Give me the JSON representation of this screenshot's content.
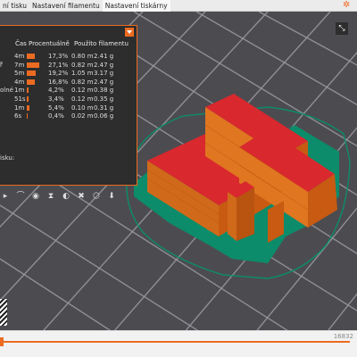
{
  "tabs": [
    "ní tisku",
    "Nastavení filamentu",
    "Nastavení tiskárny"
  ],
  "legend": {
    "headers": {
      "time": "Čas",
      "percent": "Procentuálně",
      "filament": "Použito filamentu"
    },
    "rows": [
      {
        "label": "",
        "time": "4m",
        "percent": "17,3%",
        "length": "0.80 m",
        "weight": "2.41 g",
        "bar": 0.173
      },
      {
        "label": "r",
        "time": "7m",
        "percent": "27,1%",
        "length": "0.82 m",
        "weight": "2.47 g",
        "bar": 0.271
      },
      {
        "label": "",
        "time": "5m",
        "percent": "19,2%",
        "length": "1.05 m",
        "weight": "3.17 g",
        "bar": 0.192
      },
      {
        "label": "",
        "time": "4m",
        "percent": "16,8%",
        "length": "0.82 m",
        "weight": "2.47 g",
        "bar": 0.168
      },
      {
        "label": "olné",
        "time": "1m",
        "percent": "4,2%",
        "length": "0.12 m",
        "weight": "0.38 g",
        "bar": 0.042
      },
      {
        "label": "",
        "time": "51s",
        "percent": "3,4%",
        "length": "0.12 m",
        "weight": "0.35 g",
        "bar": 0.034
      },
      {
        "label": "",
        "time": "1m",
        "percent": "5,4%",
        "length": "0.10 m",
        "weight": "0.31 g",
        "bar": 0.054
      },
      {
        "label": "",
        "time": "6s",
        "percent": "0,4%",
        "length": "0.02 m",
        "weight": "0.06 g",
        "bar": 0.004
      }
    ],
    "footer": "isku:"
  },
  "slider": {
    "value": "16832"
  },
  "colors": {
    "accent": "#ed6b21",
    "top": "#d9282e",
    "skirt": "#0c8c6a"
  }
}
